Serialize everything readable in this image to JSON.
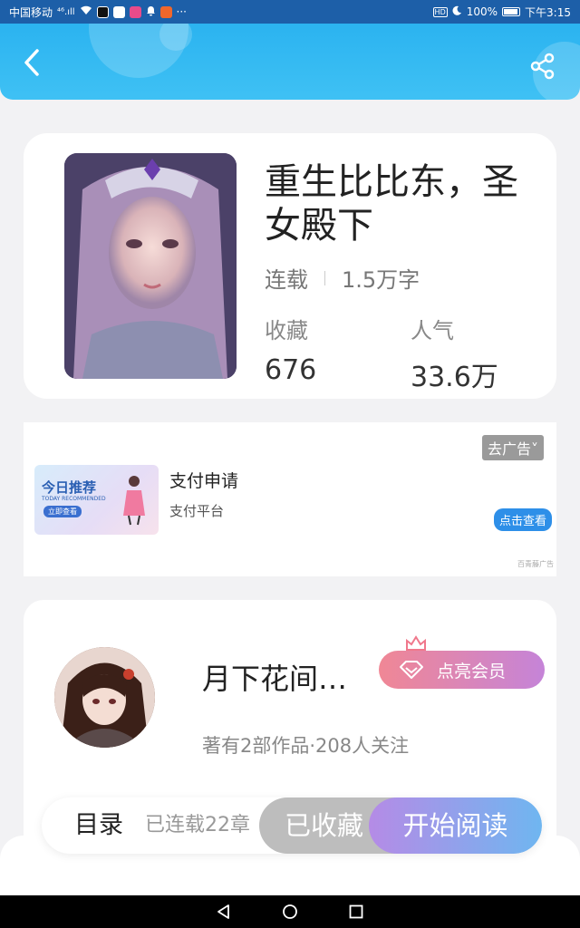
{
  "status_bar": {
    "carrier": "中国移动",
    "signal_text": "⁴⁶.ıll",
    "more": "···",
    "hd": "HD",
    "battery": "100%",
    "time": "下午3:15"
  },
  "header": {
    "back_icon": "chevron-left-icon",
    "share_icon": "share-icon"
  },
  "book": {
    "title": "重生比比东，圣女殿下",
    "status": "连载",
    "word_count": "1.5万字",
    "favorites_label": "收藏",
    "favorites_value": "676",
    "popularity_label": "人气",
    "popularity_value": "33.6万"
  },
  "ad": {
    "close_label": "去广告˅",
    "image_title": "今日推荐",
    "image_subtitle": "TODAY RECOMMENDED",
    "image_button": "立即查看",
    "title": "支付申请",
    "subtitle": "支付平台",
    "cta": "点击查看",
    "source": "百青藤广告"
  },
  "author": {
    "name": "月下花间…",
    "vip_label": "点亮会员",
    "info": "著有2部作品·208人关注"
  },
  "action_bar": {
    "toc": "目录",
    "chapters": "已连载22章",
    "collected": "已收藏",
    "read": "开始阅读"
  },
  "colors": {
    "header": "#2bb3f0",
    "vip_gradient_start": "#f08795",
    "vip_gradient_end": "#c584d8",
    "read_gradient_start": "#b58be6",
    "read_gradient_end": "#6fb6f0"
  }
}
